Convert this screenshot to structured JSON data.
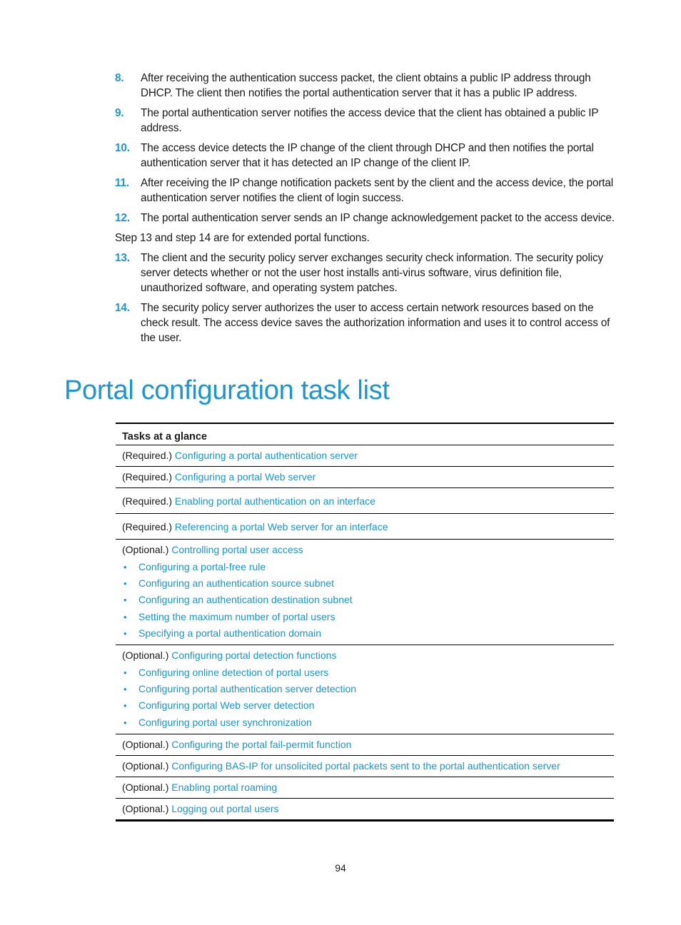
{
  "steps_part1": [
    {
      "num": "8.",
      "text": "After receiving the authentication success packet, the client obtains a public IP address through DHCP. The client then notifies the portal authentication server that it has a public IP address."
    },
    {
      "num": "9.",
      "text": "The portal authentication server notifies the access device that the client has obtained a public IP address."
    },
    {
      "num": "10.",
      "text": "The access device detects the IP change of the client through DHCP and then notifies the portal authentication server that it has detected an IP change of the client IP."
    },
    {
      "num": "11.",
      "text": "After receiving the IP change notification packets sent by the client and the access device, the portal authentication server notifies the client of login success."
    },
    {
      "num": "12.",
      "text": "The portal authentication server sends an IP change acknowledgement packet to the access device."
    }
  ],
  "note": "Step 13 and step 14 are for extended portal functions.",
  "steps_part2": [
    {
      "num": "13.",
      "text": "The client and the security policy server exchanges security check information. The security policy server detects whether or not the user host installs anti-virus software, virus definition file, unauthorized software, and operating system patches."
    },
    {
      "num": "14.",
      "text": "The security policy server authorizes the user to access certain network resources based on the check result. The access device saves the authorization information and uses it to control access of the user."
    }
  ],
  "heading": "Portal configuration task list",
  "table": {
    "header": "Tasks at a glance",
    "rows": [
      {
        "prefix": "(Required.)",
        "link": "Configuring a portal authentication server"
      },
      {
        "prefix": "(Required.)",
        "link": "Configuring a portal Web server"
      },
      {
        "prefix": "(Required.)",
        "link": "Enabling portal authentication on an interface"
      },
      {
        "prefix": "(Required.)",
        "link": "Referencing a portal Web server for an interface"
      },
      {
        "prefix": "(Optional.)",
        "link": "Controlling portal user access",
        "sub": [
          "Configuring a portal-free rule",
          "Configuring an authentication source subnet",
          "Configuring an authentication destination subnet",
          "Setting the maximum number of portal users",
          "Specifying a portal authentication domain"
        ]
      },
      {
        "prefix": "(Optional.)",
        "link": "Configuring portal detection functions",
        "sub": [
          "Configuring online detection of portal users",
          "Configuring portal authentication server detection",
          "Configuring portal Web server detection",
          "Configuring portal user synchronization"
        ]
      },
      {
        "prefix": "(Optional.)",
        "link": "Configuring the portal fail-permit function"
      },
      {
        "prefix": "(Optional.)",
        "link": "Configuring BAS-IP for unsolicited portal packets sent to the portal authentication server"
      },
      {
        "prefix": "(Optional.)",
        "link": "Enabling portal roaming"
      },
      {
        "prefix": "(Optional.)",
        "link": "Logging out portal users"
      }
    ]
  },
  "bullet_icon": "•",
  "page_number": "94"
}
